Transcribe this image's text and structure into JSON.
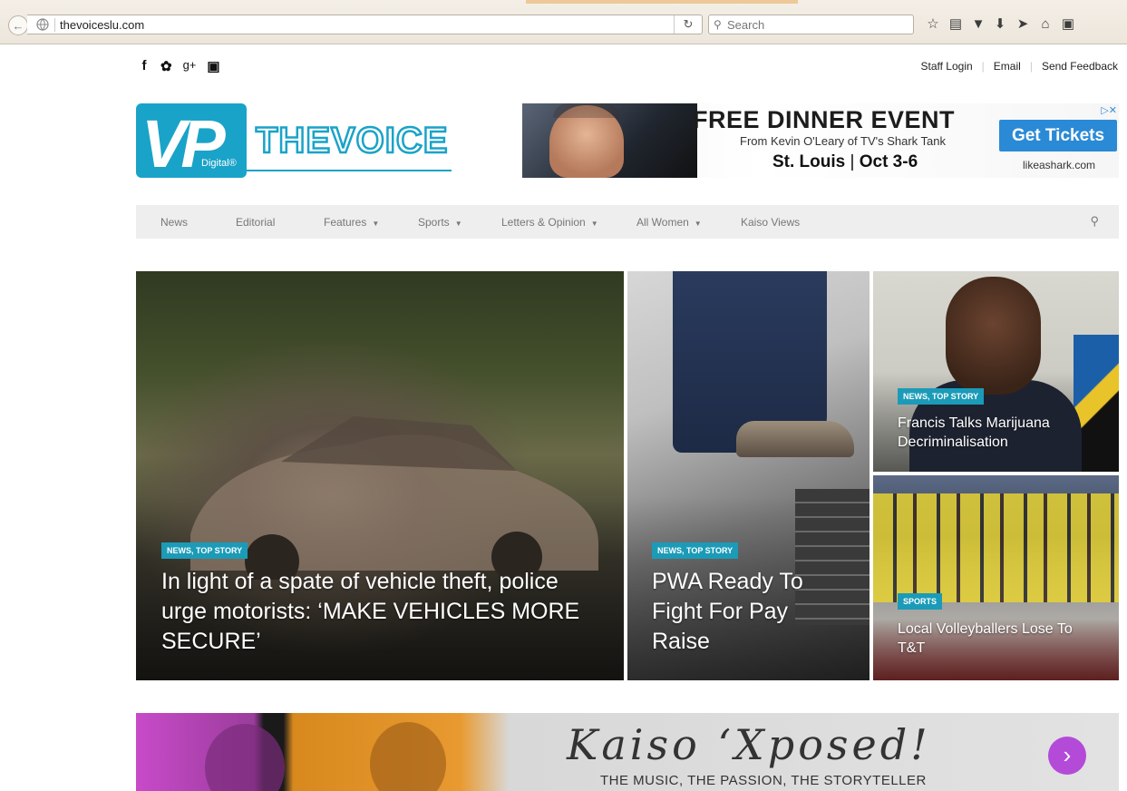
{
  "browser": {
    "url": "thevoiceslu.com",
    "search_placeholder": "Search"
  },
  "header": {
    "social_icons": [
      "facebook-icon",
      "twitter-icon",
      "google-plus-icon",
      "instagram-icon"
    ],
    "links": [
      "Staff Login",
      "Email",
      "Send Feedback"
    ]
  },
  "logo": {
    "badge": "Digital®",
    "letters": "VP",
    "wordmark": "THEVOICE"
  },
  "ad": {
    "headline": "FREE DINNER EVENT",
    "subline": "From Kevin O'Leary of TV's Shark Tank",
    "location": "St. Louis",
    "dates": "Oct 3-6",
    "button": "Get Tickets",
    "domain": "likeashark.com"
  },
  "nav": {
    "items": [
      {
        "label": "News",
        "dropdown": false
      },
      {
        "label": "Editorial",
        "dropdown": false
      },
      {
        "label": "Features",
        "dropdown": true
      },
      {
        "label": "Sports",
        "dropdown": true
      },
      {
        "label": "Letters & Opinion",
        "dropdown": true
      },
      {
        "label": "All Women",
        "dropdown": true
      },
      {
        "label": "Kaiso Views",
        "dropdown": false
      }
    ]
  },
  "stories": [
    {
      "tag": "NEWS, TOP STORY",
      "title": "In light of a spate of vehicle theft, police urge motorists: ‘MAKE VEHICLES MORE SECURE’"
    },
    {
      "tag": "NEWS, TOP STORY",
      "title": "PWA Ready To Fight For Pay Raise"
    },
    {
      "tag": "NEWS, TOP STORY",
      "title": "Francis Talks Marijuana Decriminalisation"
    },
    {
      "tag": "SPORTS",
      "title": "Local Volleyballers Lose To T&T"
    }
  ],
  "banner": {
    "title": "Kaiso ‘Xposed!",
    "subtitle": "THE MUSIC, THE PASSION, THE STORYTELLER"
  },
  "colors": {
    "tag_bg": "#1b9bb8",
    "nav_bg": "#eeeeee",
    "logo_blue": "#1aa3c8"
  }
}
